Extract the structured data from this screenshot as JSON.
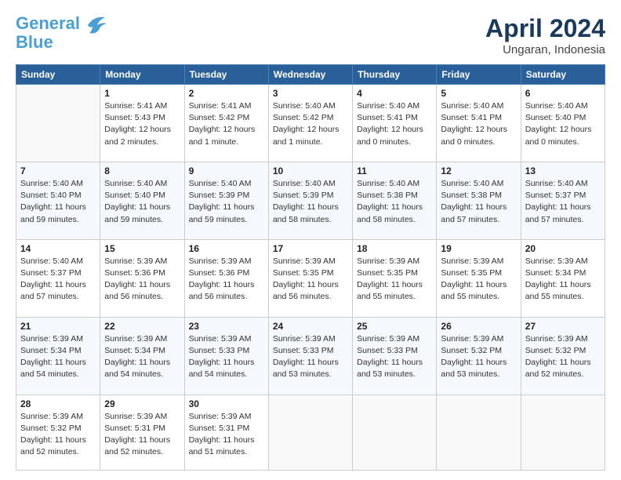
{
  "logo": {
    "line1": "General",
    "line2": "Blue"
  },
  "title": "April 2024",
  "location": "Ungaran, Indonesia",
  "days_header": [
    "Sunday",
    "Monday",
    "Tuesday",
    "Wednesday",
    "Thursday",
    "Friday",
    "Saturday"
  ],
  "weeks": [
    [
      {
        "day": "",
        "info": ""
      },
      {
        "day": "1",
        "info": "Sunrise: 5:41 AM\nSunset: 5:43 PM\nDaylight: 12 hours\nand 2 minutes."
      },
      {
        "day": "2",
        "info": "Sunrise: 5:41 AM\nSunset: 5:42 PM\nDaylight: 12 hours\nand 1 minute."
      },
      {
        "day": "3",
        "info": "Sunrise: 5:40 AM\nSunset: 5:42 PM\nDaylight: 12 hours\nand 1 minute."
      },
      {
        "day": "4",
        "info": "Sunrise: 5:40 AM\nSunset: 5:41 PM\nDaylight: 12 hours\nand 0 minutes."
      },
      {
        "day": "5",
        "info": "Sunrise: 5:40 AM\nSunset: 5:41 PM\nDaylight: 12 hours\nand 0 minutes."
      },
      {
        "day": "6",
        "info": "Sunrise: 5:40 AM\nSunset: 5:40 PM\nDaylight: 12 hours\nand 0 minutes."
      }
    ],
    [
      {
        "day": "7",
        "info": "Sunrise: 5:40 AM\nSunset: 5:40 PM\nDaylight: 11 hours\nand 59 minutes."
      },
      {
        "day": "8",
        "info": "Sunrise: 5:40 AM\nSunset: 5:40 PM\nDaylight: 11 hours\nand 59 minutes."
      },
      {
        "day": "9",
        "info": "Sunrise: 5:40 AM\nSunset: 5:39 PM\nDaylight: 11 hours\nand 59 minutes."
      },
      {
        "day": "10",
        "info": "Sunrise: 5:40 AM\nSunset: 5:39 PM\nDaylight: 11 hours\nand 58 minutes."
      },
      {
        "day": "11",
        "info": "Sunrise: 5:40 AM\nSunset: 5:38 PM\nDaylight: 11 hours\nand 58 minutes."
      },
      {
        "day": "12",
        "info": "Sunrise: 5:40 AM\nSunset: 5:38 PM\nDaylight: 11 hours\nand 57 minutes."
      },
      {
        "day": "13",
        "info": "Sunrise: 5:40 AM\nSunset: 5:37 PM\nDaylight: 11 hours\nand 57 minutes."
      }
    ],
    [
      {
        "day": "14",
        "info": "Sunrise: 5:40 AM\nSunset: 5:37 PM\nDaylight: 11 hours\nand 57 minutes."
      },
      {
        "day": "15",
        "info": "Sunrise: 5:39 AM\nSunset: 5:36 PM\nDaylight: 11 hours\nand 56 minutes."
      },
      {
        "day": "16",
        "info": "Sunrise: 5:39 AM\nSunset: 5:36 PM\nDaylight: 11 hours\nand 56 minutes."
      },
      {
        "day": "17",
        "info": "Sunrise: 5:39 AM\nSunset: 5:35 PM\nDaylight: 11 hours\nand 56 minutes."
      },
      {
        "day": "18",
        "info": "Sunrise: 5:39 AM\nSunset: 5:35 PM\nDaylight: 11 hours\nand 55 minutes."
      },
      {
        "day": "19",
        "info": "Sunrise: 5:39 AM\nSunset: 5:35 PM\nDaylight: 11 hours\nand 55 minutes."
      },
      {
        "day": "20",
        "info": "Sunrise: 5:39 AM\nSunset: 5:34 PM\nDaylight: 11 hours\nand 55 minutes."
      }
    ],
    [
      {
        "day": "21",
        "info": "Sunrise: 5:39 AM\nSunset: 5:34 PM\nDaylight: 11 hours\nand 54 minutes."
      },
      {
        "day": "22",
        "info": "Sunrise: 5:39 AM\nSunset: 5:34 PM\nDaylight: 11 hours\nand 54 minutes."
      },
      {
        "day": "23",
        "info": "Sunrise: 5:39 AM\nSunset: 5:33 PM\nDaylight: 11 hours\nand 54 minutes."
      },
      {
        "day": "24",
        "info": "Sunrise: 5:39 AM\nSunset: 5:33 PM\nDaylight: 11 hours\nand 53 minutes."
      },
      {
        "day": "25",
        "info": "Sunrise: 5:39 AM\nSunset: 5:33 PM\nDaylight: 11 hours\nand 53 minutes."
      },
      {
        "day": "26",
        "info": "Sunrise: 5:39 AM\nSunset: 5:32 PM\nDaylight: 11 hours\nand 53 minutes."
      },
      {
        "day": "27",
        "info": "Sunrise: 5:39 AM\nSunset: 5:32 PM\nDaylight: 11 hours\nand 52 minutes."
      }
    ],
    [
      {
        "day": "28",
        "info": "Sunrise: 5:39 AM\nSunset: 5:32 PM\nDaylight: 11 hours\nand 52 minutes."
      },
      {
        "day": "29",
        "info": "Sunrise: 5:39 AM\nSunset: 5:31 PM\nDaylight: 11 hours\nand 52 minutes."
      },
      {
        "day": "30",
        "info": "Sunrise: 5:39 AM\nSunset: 5:31 PM\nDaylight: 11 hours\nand 51 minutes."
      },
      {
        "day": "",
        "info": ""
      },
      {
        "day": "",
        "info": ""
      },
      {
        "day": "",
        "info": ""
      },
      {
        "day": "",
        "info": ""
      }
    ]
  ]
}
